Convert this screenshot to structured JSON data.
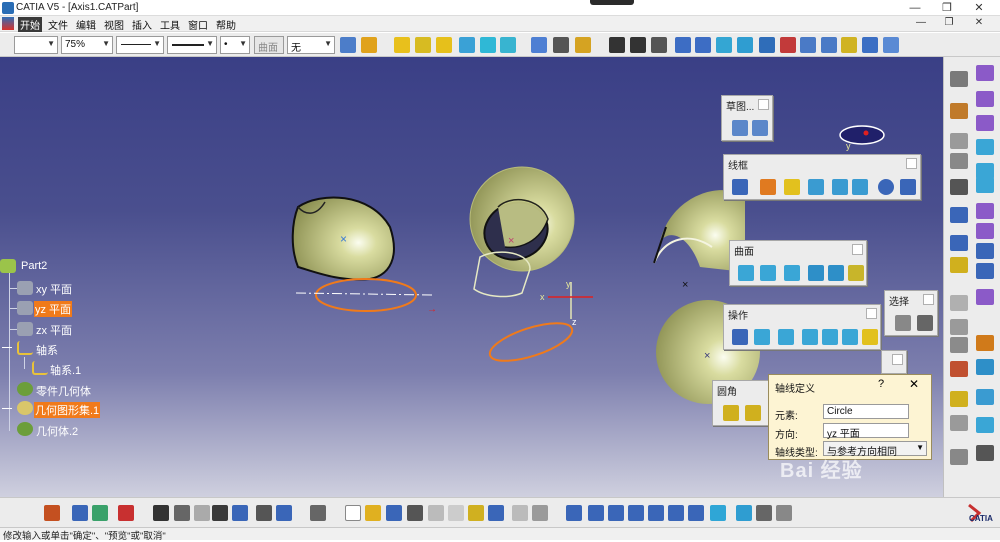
{
  "window": {
    "title": "CATIA V5 - [Axis1.CATPart]",
    "controls": {
      "minimize": "—",
      "restore": "❐",
      "close": "✕"
    }
  },
  "menu": {
    "items": [
      "开始",
      "文件",
      "编辑",
      "视图",
      "插入",
      "工具",
      "窗口",
      "帮助"
    ],
    "doc_controls": {
      "minimize": "—",
      "restore": "❐",
      "close": "✕"
    }
  },
  "top_toolbar": {
    "zoom": "75%",
    "layer": "无",
    "combo_disabled": "曲面"
  },
  "tree": {
    "root": "Part2",
    "items": [
      {
        "label": "xy 平面",
        "highlighted": false
      },
      {
        "label": "yz 平面",
        "highlighted": true
      },
      {
        "label": "zx 平面",
        "highlighted": false
      },
      {
        "label": "轴系",
        "highlighted": false
      },
      {
        "label": "轴系.1",
        "highlighted": false
      },
      {
        "label": "零件几何体",
        "highlighted": false
      },
      {
        "label": "几何图形集.1",
        "highlighted": true
      },
      {
        "label": "几何体.2",
        "highlighted": false
      }
    ]
  },
  "floating_toolbars": {
    "sketch": "草图...",
    "wireframe": "线框",
    "surfaces": "曲面",
    "operations": "操作",
    "select": "选择",
    "fillet": "圆角"
  },
  "dialog": {
    "title": "轴线定义",
    "help": "?",
    "close": "✕",
    "element_label": "元素:",
    "element_value": "Circle",
    "direction_label": "方向:",
    "direction_value": "yz 平面",
    "type_label": "轴线类型:",
    "type_value": "与参考方向相同"
  },
  "viewport": {
    "axis_labels": {
      "x": "x",
      "y": "y",
      "z": "z"
    },
    "small_y": "y"
  },
  "status": {
    "text": "修改输入或单击\"确定\"、\"预览\"或\"取消\""
  },
  "watermark": "Bai 经验",
  "logo": "CATIA",
  "colors": {
    "viewport_top": "#3a3f86",
    "surface": "#c8cc88",
    "highlight": "#f07a1a",
    "curve_orange": "#f07a1a",
    "dialog_bg": "#fdf4d3"
  }
}
